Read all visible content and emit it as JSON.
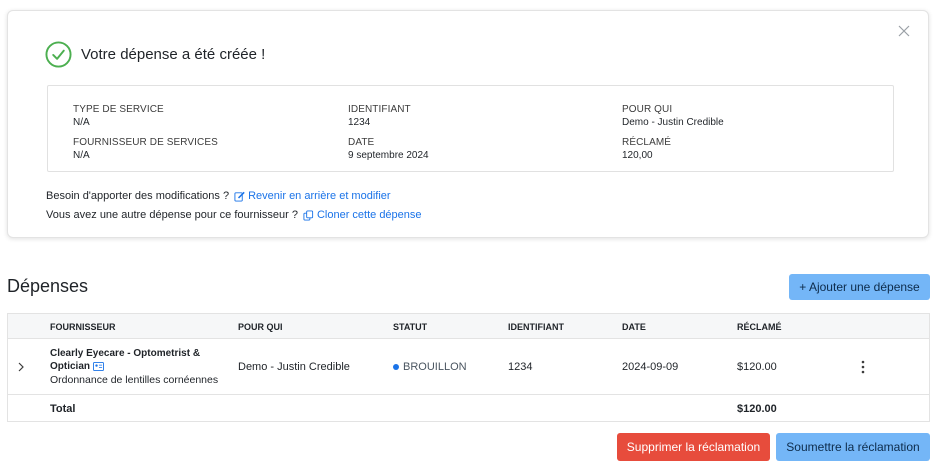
{
  "success": {
    "title": "Votre dépense a été créée !",
    "fields": {
      "service_type": {
        "label": "TYPE DE SERVICE",
        "value": "N/A"
      },
      "identifier": {
        "label": "IDENTIFIANT",
        "value": "1234"
      },
      "for_whom": {
        "label": "POUR QUI",
        "value": "Demo - Justin Credible"
      },
      "provider": {
        "label": "FOURNISSEUR DE SERVICES",
        "value": "N/A"
      },
      "date": {
        "label": "DATE",
        "value": "9 septembre 2024"
      },
      "claimed": {
        "label": "RÉCLAMÉ",
        "value": "120,00"
      }
    },
    "modify_prompt": "Besoin d'apporter des modifications ?",
    "modify_link": "Revenir en arrière et modifier",
    "clone_prompt": "Vous avez une autre dépense pour ce fournisseur ?",
    "clone_link": "Cloner cette dépense"
  },
  "expenses": {
    "title": "Dépenses",
    "add_button": "+ Ajouter une dépense",
    "columns": {
      "supplier": "FOURNISSEUR",
      "for_whom": "POUR QUI",
      "status": "STATUT",
      "identifier": "IDENTIFIANT",
      "date": "DATE",
      "claimed": "RÉCLAMÉ"
    },
    "rows": [
      {
        "supplier_name": "Clearly Eyecare - Optometrist & Optician",
        "supplier_desc": "Ordonnance de lentilles cornéennes",
        "for_whom": "Demo - Justin Credible",
        "status": "BROUILLON",
        "identifier": "1234",
        "date": "2024-09-09",
        "claimed": "$120.00"
      }
    ],
    "total_label": "Total",
    "total_value": "$120.00"
  },
  "actions": {
    "delete": "Supprimer la réclamation",
    "submit": "Soumettre la réclamation"
  },
  "colors": {
    "accent": "#1a73e8",
    "success": "#4caf50",
    "primary_button": "#74b6f7",
    "danger_button": "#e74c3c"
  },
  "icons": [
    "close-icon",
    "check-circle-icon",
    "edit-icon",
    "copy-icon",
    "chevron-right-icon",
    "id-card-icon",
    "kebab-icon"
  ]
}
